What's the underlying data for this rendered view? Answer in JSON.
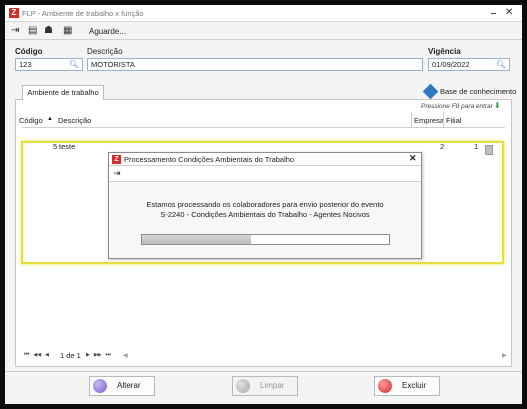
{
  "window": {
    "title": "FLP - Ambiente de trabalho x função",
    "app_badge": "Z",
    "minimize": "‒",
    "close": "✕"
  },
  "toolbar": {
    "status": "Aguarde..."
  },
  "form": {
    "codigo_label": "Código",
    "codigo_value": "123",
    "descricao_label": "Descrição",
    "descricao_value": "MOTORISTA",
    "vigencia_label": "Vigência",
    "vigencia_value": "01/09/2022"
  },
  "tabs": [
    {
      "label": "Ambiente de trabalho"
    }
  ],
  "knowledge_base": {
    "label": "Base de conhecimento"
  },
  "grid": {
    "hint": "Pressione F8 para entrar",
    "columns": {
      "codigo": "Código",
      "sort_arrow": "▲",
      "descricao": "Descrição",
      "empresa": "Empresa",
      "filial": "Filial"
    },
    "rows": [
      {
        "codigo": "5",
        "descricao": "teste",
        "empresa": "2",
        "filial": "1"
      }
    ]
  },
  "dialog": {
    "title": "Processamento Condições Ambientais do Trabalho",
    "badge": "Z",
    "close": "✕",
    "message_line1": "Estamos processando os colaboradores para envio posterior do evento",
    "message_line2": "S-2240 - Condições Ambientais do Trabalho - Agentes Nocivos",
    "progress": 0.44
  },
  "pager": {
    "first": "⏮",
    "prev_page": "◀◀",
    "prev": "◀",
    "text": "1 de 1",
    "next": "▶",
    "next_page": "▶▶",
    "last": "⏭"
  },
  "buttons": {
    "alterar": "Alterar",
    "limpar": "Limpar",
    "excluir": "Excluir"
  },
  "colors": {
    "highlight": "#e6df3c",
    "brand_red": "#d62b2b",
    "accent_blue": "#3a7bd5"
  }
}
